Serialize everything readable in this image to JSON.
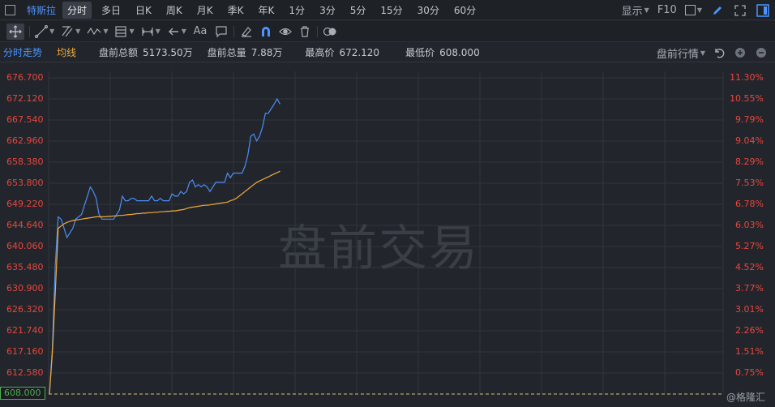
{
  "toolbar1": {
    "stock_name": "特斯拉",
    "timeframes": [
      "分时",
      "多日",
      "日K",
      "周K",
      "月K",
      "季K",
      "年K",
      "1分",
      "3分",
      "5分",
      "15分",
      "30分",
      "60分"
    ],
    "active_index": 0,
    "display_label": "显示",
    "f10_label": "F10"
  },
  "toolbar2": {
    "text_tool_label": "Aa"
  },
  "infobar": {
    "tab_intraday": "分时走势",
    "tab_avg": "均线",
    "premarket_amount_label": "盘前总额",
    "premarket_amount_value": "5173.50万",
    "premarket_volume_label": "盘前总量",
    "premarket_volume_value": "7.88万",
    "high_label": "最高价",
    "high_value": "672.120",
    "low_label": "最低价",
    "low_value": "608.000",
    "premarket_quote_label": "盘前行情"
  },
  "chart_data": {
    "type": "line",
    "left_ticks": [
      "676.700",
      "672.120",
      "667.540",
      "662.960",
      "658.380",
      "653.800",
      "649.220",
      "644.640",
      "640.060",
      "635.480",
      "630.900",
      "626.320",
      "621.740",
      "617.160",
      "612.580",
      "608.000"
    ],
    "right_ticks": [
      "11.30%",
      "10.55%",
      "9.79%",
      "9.04%",
      "8.29%",
      "7.53%",
      "6.78%",
      "6.03%",
      "5.27%",
      "4.52%",
      "3.77%",
      "3.01%",
      "2.26%",
      "1.51%",
      "0.75%"
    ],
    "ylim": [
      608.0,
      676.7
    ],
    "base_price": "608.000",
    "watermark": "盘前交易",
    "series": [
      {
        "color": "#4d8df5",
        "values": [
          608.0,
          618.0,
          636.0,
          646.5,
          646.0,
          644.0,
          642.0,
          643.0,
          644.0,
          646.0,
          646.5,
          647.0,
          649.0,
          651.0,
          653.0,
          652.0,
          650.5,
          647.0,
          646.0,
          646.0,
          646.0,
          646.0,
          646.0,
          647.0,
          648.0,
          651.0,
          650.0,
          650.0,
          650.5,
          650.5,
          650.0,
          650.0,
          650.0,
          650.0,
          650.0,
          651.0,
          650.0,
          650.0,
          650.5,
          650.0,
          650.0,
          650.0,
          651.5,
          651.0,
          651.0,
          652.0,
          651.5,
          652.0,
          654.0,
          654.5,
          653.0,
          653.5,
          653.0,
          653.5,
          653.0,
          652.0,
          653.0,
          654.0,
          654.0,
          654.0,
          654.0,
          656.0,
          655.0,
          656.0,
          656.0,
          656.0,
          656.0,
          657.5,
          660.0,
          664.0,
          664.5,
          663.0,
          664.0,
          666.0,
          669.0,
          669.0,
          670.0,
          671.0,
          672.12,
          671.0
        ]
      },
      {
        "color": "#f2a93b",
        "values": [
          608.0,
          617.0,
          630.0,
          644.0,
          644.5,
          645.0,
          645.3,
          645.5,
          645.7,
          645.8,
          645.9,
          646.0,
          646.1,
          646.2,
          646.3,
          646.4,
          646.5,
          646.5,
          646.5,
          646.5,
          646.6,
          646.6,
          646.7,
          646.7,
          646.8,
          646.8,
          646.9,
          647.0,
          647.0,
          647.1,
          647.2,
          647.2,
          647.3,
          647.3,
          647.4,
          647.4,
          647.5,
          647.5,
          647.6,
          647.6,
          647.7,
          647.7,
          647.8,
          647.8,
          647.9,
          648.0,
          648.1,
          648.3,
          648.5,
          648.6,
          648.7,
          648.8,
          648.9,
          649.0,
          649.0,
          649.1,
          649.2,
          649.3,
          649.4,
          649.5,
          649.6,
          649.7,
          650.0,
          650.2,
          650.5,
          651.0,
          651.5,
          652.0,
          652.5,
          653.0,
          653.5,
          654.0,
          654.3,
          654.6,
          654.9,
          655.2,
          655.5,
          655.8,
          656.1,
          656.4
        ]
      }
    ]
  }
}
